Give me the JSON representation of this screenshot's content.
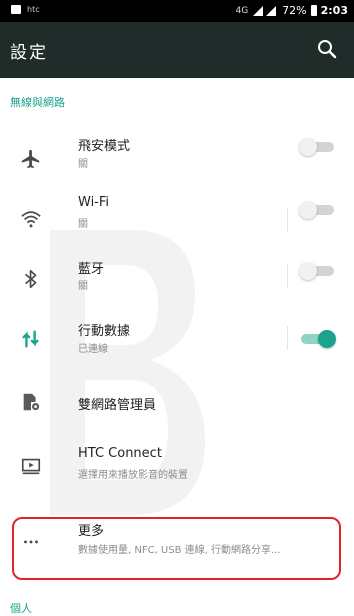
{
  "status_bar": {
    "carrier": "htc",
    "signal_text": "4G",
    "battery": "72%",
    "time": "2:03"
  },
  "app_bar": {
    "title": "設定",
    "search_icon": "search-icon"
  },
  "sections": [
    {
      "label": "無線與網路"
    },
    {
      "label": "個人"
    }
  ],
  "items": [
    {
      "title": "飛安模式",
      "subtitle": "關",
      "icon": "airplane-icon",
      "toggle": false
    },
    {
      "title": "Wi-Fi",
      "subtitle": "關",
      "icon": "wifi-icon",
      "toggle": false
    },
    {
      "title": "藍牙",
      "subtitle": "關",
      "icon": "bluetooth-icon",
      "toggle": false
    },
    {
      "title": "行動數據",
      "subtitle": "已連線",
      "icon": "mobile-data-icon",
      "toggle": true
    },
    {
      "title": "雙網路管理員",
      "subtitle": "",
      "icon": "dual-network-icon"
    },
    {
      "title": "HTC Connect",
      "subtitle": "選擇用來播放影音的裝置",
      "icon": "htc-connect-icon"
    },
    {
      "title": "更多",
      "subtitle": "數據使用量, NFC, USB 連線, 行動網路分享...",
      "icon": "more-icon"
    }
  ],
  "colors": {
    "accent": "#1ba38c",
    "app_bar": "#1f2c2a",
    "highlight": "#e0242a"
  }
}
